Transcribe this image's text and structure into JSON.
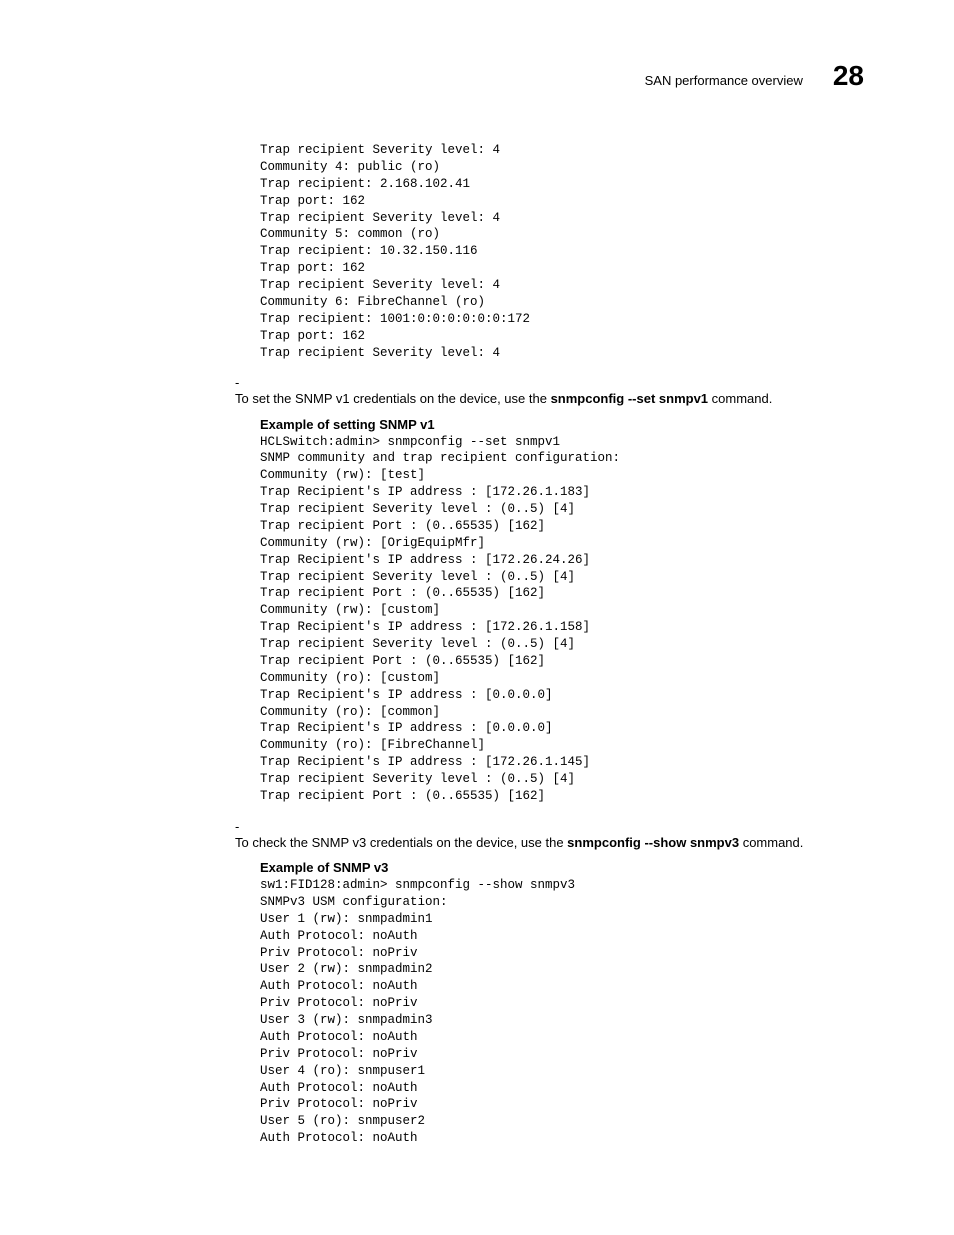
{
  "header": {
    "title": "SAN performance overview",
    "chapter": "28"
  },
  "code_block_1": "Trap recipient Severity level: 4\nCommunity 4: public (ro)\nTrap recipient: 2.168.102.41\nTrap port: 162\nTrap recipient Severity level: 4\nCommunity 5: common (ro)\nTrap recipient: 10.32.150.116\nTrap port: 162\nTrap recipient Severity level: 4\nCommunity 6: FibreChannel (ro)\nTrap recipient: 1001:0:0:0:0:0:0:172\nTrap port: 162\nTrap recipient Severity level: 4",
  "bullet_1": {
    "prefix": "To set the SNMP v1 credentials on the device, use the ",
    "command": "snmpconfig --set snmpv1",
    "suffix": " command."
  },
  "example_1_label": "Example of setting SNMP v1",
  "code_block_2": "HCLSwitch:admin> snmpconfig --set snmpv1\nSNMP community and trap recipient configuration:\nCommunity (rw): [test]\nTrap Recipient's IP address : [172.26.1.183]\nTrap recipient Severity level : (0..5) [4]\nTrap recipient Port : (0..65535) [162]\nCommunity (rw): [OrigEquipMfr]\nTrap Recipient's IP address : [172.26.24.26]\nTrap recipient Severity level : (0..5) [4]\nTrap recipient Port : (0..65535) [162]\nCommunity (rw): [custom]\nTrap Recipient's IP address : [172.26.1.158]\nTrap recipient Severity level : (0..5) [4]\nTrap recipient Port : (0..65535) [162]\nCommunity (ro): [custom]\nTrap Recipient's IP address : [0.0.0.0]\nCommunity (ro): [common]\nTrap Recipient's IP address : [0.0.0.0]\nCommunity (ro): [FibreChannel]\nTrap Recipient's IP address : [172.26.1.145]\nTrap recipient Severity level : (0..5) [4]\nTrap recipient Port : (0..65535) [162]",
  "bullet_2": {
    "prefix": "To check the SNMP v3 credentials on the device, use the ",
    "command": "snmpconfig --show snmpv3",
    "suffix": " command."
  },
  "example_2_label": "Example of SNMP v3",
  "code_block_3": "sw1:FID128:admin> snmpconfig --show snmpv3\nSNMPv3 USM configuration:\nUser 1 (rw): snmpadmin1\nAuth Protocol: noAuth\nPriv Protocol: noPriv\nUser 2 (rw): snmpadmin2\nAuth Protocol: noAuth\nPriv Protocol: noPriv\nUser 3 (rw): snmpadmin3\nAuth Protocol: noAuth\nPriv Protocol: noPriv\nUser 4 (ro): snmpuser1\nAuth Protocol: noAuth\nPriv Protocol: noPriv\nUser 5 (ro): snmpuser2\nAuth Protocol: noAuth"
}
